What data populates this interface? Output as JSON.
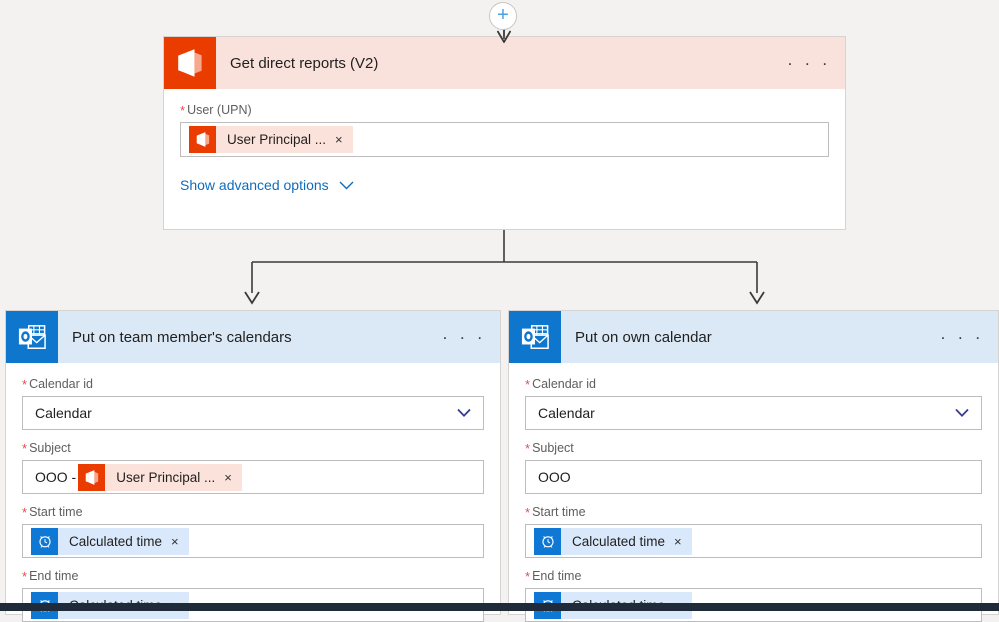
{
  "canvas": {
    "background_color": "#f3f2f1",
    "add_step_button": {
      "label": "+",
      "icon": "plus-icon"
    }
  },
  "nodes": [
    {
      "id": "get-direct-reports",
      "title": "Get direct reports (V2)",
      "connector_icon": "office365-icon",
      "header_color": "#fae2dc",
      "icon_color": "#eb3c00",
      "overflow_menu": "· · ·",
      "fields": [
        {
          "label": "User (UPN)",
          "required": true,
          "type": "token",
          "token": {
            "label": "User Principal ...",
            "icon": "office365-icon",
            "remove": "×"
          }
        }
      ],
      "advanced_link": {
        "label": "Show advanced options",
        "icon": "chevron-down-icon"
      }
    },
    {
      "id": "put-on-team-member-calendars",
      "title": "Put on team member's calendars",
      "connector_icon": "outlook-icon",
      "header_color": "#dbe9f7",
      "icon_color": "#0f76ce",
      "overflow_menu": "· · ·",
      "fields": [
        {
          "label": "Calendar id",
          "required": true,
          "type": "dropdown",
          "value": "Calendar",
          "icon": "chevron-down-icon"
        },
        {
          "label": "Subject",
          "required": true,
          "type": "token-with-prefix",
          "prefix": "OOO - ",
          "token": {
            "label": "User Principal ...",
            "icon": "office365-icon",
            "remove": "×"
          }
        },
        {
          "label": "Start time",
          "required": true,
          "type": "token",
          "token": {
            "label": "Calculated time",
            "icon": "clock-icon",
            "remove": "×"
          }
        },
        {
          "label": "End time",
          "required": true,
          "type": "token",
          "token": {
            "label": "Calculated time",
            "icon": "clock-icon",
            "remove": "×"
          }
        }
      ]
    },
    {
      "id": "put-on-own-calendar",
      "title": "Put on own calendar",
      "connector_icon": "outlook-icon",
      "header_color": "#dbe9f7",
      "icon_color": "#0f76ce",
      "overflow_menu": "· · ·",
      "fields": [
        {
          "label": "Calendar id",
          "required": true,
          "type": "dropdown",
          "value": "Calendar",
          "icon": "chevron-down-icon"
        },
        {
          "label": "Subject",
          "required": true,
          "type": "text",
          "value": "OOO"
        },
        {
          "label": "Start time",
          "required": true,
          "type": "token",
          "token": {
            "label": "Calculated time",
            "icon": "clock-icon",
            "remove": "×"
          }
        },
        {
          "label": "End time",
          "required": true,
          "type": "token",
          "token": {
            "label": "Calculated time",
            "icon": "clock-icon",
            "remove": "×"
          }
        }
      ]
    }
  ],
  "colors": {
    "accent_blue": "#0f6cbd",
    "office_orange": "#eb3c00",
    "outlook_blue": "#0f76ce",
    "required_red": "#e8504a",
    "taskbar": "#1f2b38"
  }
}
